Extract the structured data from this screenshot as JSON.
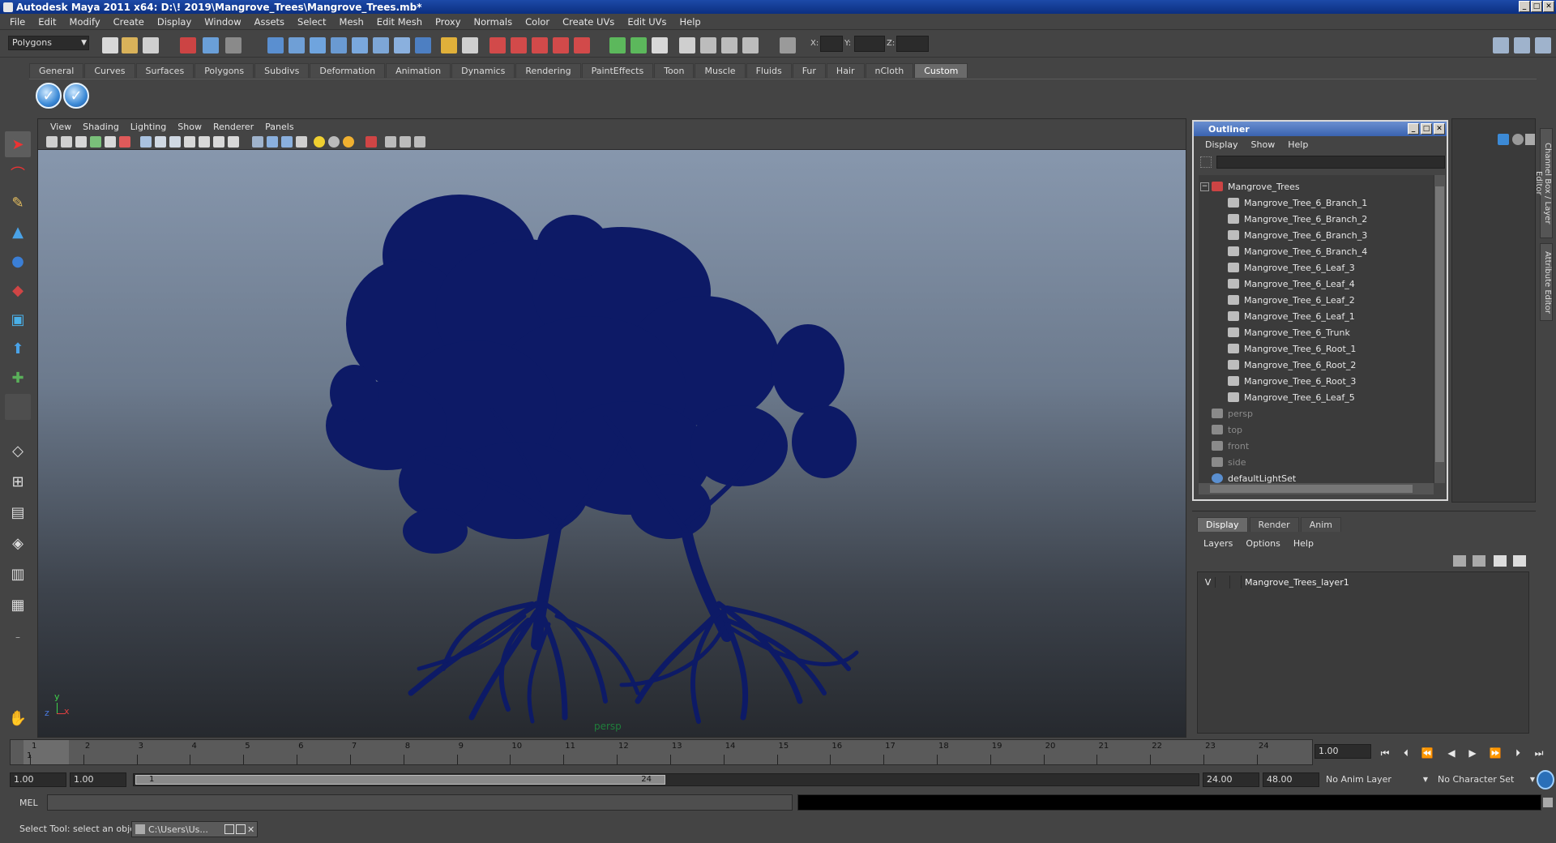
{
  "window": {
    "title": "Autodesk Maya 2011 x64: D:\\! 2019\\Mangrove_Trees\\Mangrove_Trees.mb*"
  },
  "menubar": [
    "File",
    "Edit",
    "Modify",
    "Create",
    "Display",
    "Window",
    "Assets",
    "Select",
    "Mesh",
    "Edit Mesh",
    "Proxy",
    "Normals",
    "Color",
    "Create UVs",
    "Edit UVs",
    "Help"
  ],
  "status": {
    "mode": "Polygons",
    "x_label": "X:",
    "y_label": "Y:",
    "z_label": "Z:"
  },
  "shelf": {
    "tabs": [
      "General",
      "Curves",
      "Surfaces",
      "Polygons",
      "Subdivs",
      "Deformation",
      "Animation",
      "Dynamics",
      "Rendering",
      "PaintEffects",
      "Toon",
      "Muscle",
      "Fluids",
      "Fur",
      "Hair",
      "nCloth",
      "Custom"
    ],
    "active_tab": "Custom",
    "buttons": [
      "check-icon",
      "check-icon"
    ]
  },
  "viewport": {
    "menu": [
      "View",
      "Shading",
      "Lighting",
      "Show",
      "Renderer",
      "Panels"
    ],
    "camera": "persp",
    "axis_y": "y",
    "axis_x": "x",
    "axis_z": "z",
    "model_color": "#0d1a66",
    "background_top": "#8797ad",
    "background_bottom": "#26292e"
  },
  "outliner": {
    "title": "Outliner",
    "menu": [
      "Display",
      "Show",
      "Help"
    ],
    "items": [
      {
        "label": "Mangrove_Trees",
        "indent": 0,
        "dim": false
      },
      {
        "label": "Mangrove_Tree_6_Branch_1",
        "indent": 1,
        "dim": false
      },
      {
        "label": "Mangrove_Tree_6_Branch_2",
        "indent": 1,
        "dim": false
      },
      {
        "label": "Mangrove_Tree_6_Branch_3",
        "indent": 1,
        "dim": false
      },
      {
        "label": "Mangrove_Tree_6_Branch_4",
        "indent": 1,
        "dim": false
      },
      {
        "label": "Mangrove_Tree_6_Leaf_3",
        "indent": 1,
        "dim": false
      },
      {
        "label": "Mangrove_Tree_6_Leaf_4",
        "indent": 1,
        "dim": false
      },
      {
        "label": "Mangrove_Tree_6_Leaf_2",
        "indent": 1,
        "dim": false
      },
      {
        "label": "Mangrove_Tree_6_Leaf_1",
        "indent": 1,
        "dim": false
      },
      {
        "label": "Mangrove_Tree_6_Trunk",
        "indent": 1,
        "dim": false
      },
      {
        "label": "Mangrove_Tree_6_Root_1",
        "indent": 1,
        "dim": false
      },
      {
        "label": "Mangrove_Tree_6_Root_2",
        "indent": 1,
        "dim": false
      },
      {
        "label": "Mangrove_Tree_6_Root_3",
        "indent": 1,
        "dim": false
      },
      {
        "label": "Mangrove_Tree_6_Leaf_5",
        "indent": 1,
        "dim": false
      },
      {
        "label": "persp",
        "indent": 0,
        "dim": true
      },
      {
        "label": "top",
        "indent": 0,
        "dim": true
      },
      {
        "label": "front",
        "indent": 0,
        "dim": true
      },
      {
        "label": "side",
        "indent": 0,
        "dim": true
      },
      {
        "label": "defaultLightSet",
        "indent": 0,
        "dim": false
      }
    ]
  },
  "side_tabs": [
    "Channel Box / Layer Editor",
    "Attribute Editor"
  ],
  "layer_editor": {
    "tabs": [
      "Display",
      "Render",
      "Anim"
    ],
    "active_tab": "Display",
    "menu": [
      "Layers",
      "Options",
      "Help"
    ],
    "layers": [
      {
        "visible": "V",
        "name": "Mangrove_Trees_layer1"
      }
    ]
  },
  "timeline": {
    "ticks": [
      "1",
      "2",
      "3",
      "4",
      "5",
      "6",
      "7",
      "8",
      "9",
      "10",
      "11",
      "12",
      "13",
      "14",
      "15",
      "16",
      "17",
      "18",
      "19",
      "20",
      "21",
      "22",
      "23",
      "24"
    ],
    "current_frame_marker": "1",
    "current_frame": "1.00"
  },
  "range": {
    "start": "1.00",
    "playback_start": "1.00",
    "range_start_label": "1",
    "range_end_label": "24",
    "playback_end": "24.00",
    "end": "48.00",
    "anim_layer": "No Anim Layer",
    "character_set": "No Character Set"
  },
  "command": {
    "label": "MEL"
  },
  "help": {
    "text": "Select Tool: select an object",
    "task": "C:\\Users\\Us..."
  }
}
